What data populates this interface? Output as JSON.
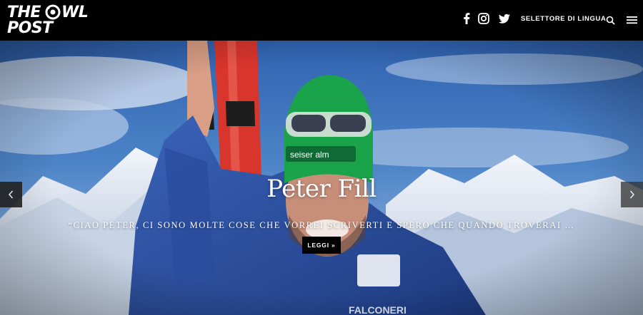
{
  "header": {
    "logo": {
      "line1": "THE",
      "line1b": "WL",
      "line2": "POST"
    },
    "social": [
      "facebook-icon",
      "instagram-icon",
      "twitter-icon"
    ],
    "language_selector": "SELETTORE DI LINGUA",
    "search_icon": "search-icon",
    "menu_icon": "hamburger-menu-icon"
  },
  "hero": {
    "title": "Peter Fill",
    "excerpt": "“CIAO PETER, CI SONO MOLTE COSE CHE VORREI SCRIVERTI E SPERO CHE QUANDO TROVERAI …",
    "button": "LEGGI »",
    "prev_icon": "chevron-left-icon",
    "next_icon": "chevron-right-icon"
  },
  "colors": {
    "header_bg": "#000000",
    "sky": "#3f73b8",
    "snow": "#dfe7f2",
    "jacket": "#2b4fa0",
    "hat": "#18a04a",
    "ski": "#e0382f"
  }
}
